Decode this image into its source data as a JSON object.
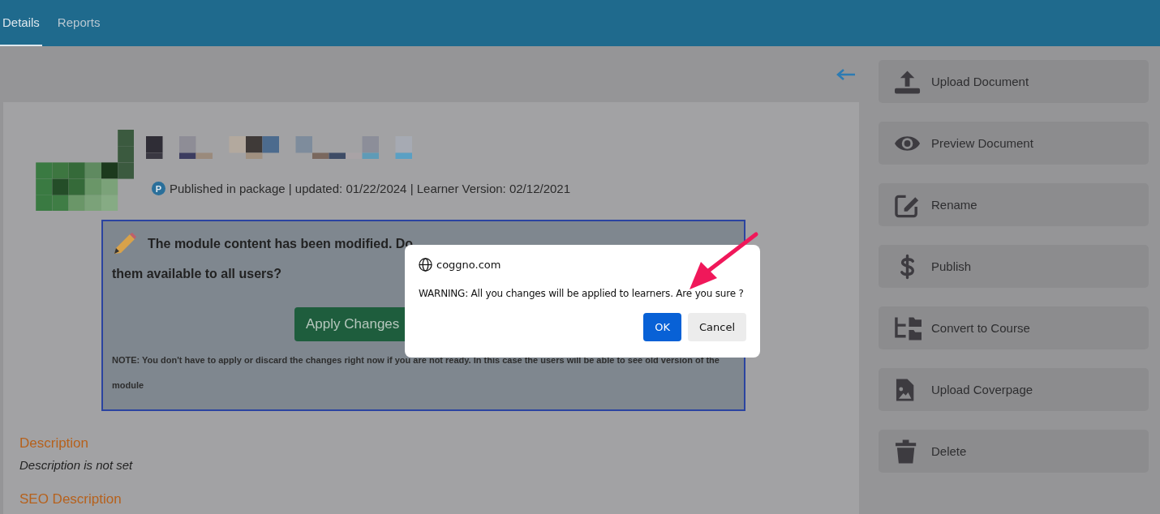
{
  "tabs": [
    {
      "label": "Details",
      "selected": true
    },
    {
      "label": "Reports",
      "selected": false
    }
  ],
  "module": {
    "status_badge": "P",
    "status": "Published in package | updated: 01/22/2024 | Learner Version: 02/12/2021",
    "notice": {
      "message_lines": [
        "The module content has been modified. Do",
        "them available to all users?"
      ],
      "apply_button": "Apply Changes",
      "note": "NOTE: You don't have to apply or discard the changes right now if you are not ready. In this case the users will be able to see old version of the module"
    }
  },
  "sections": [
    {
      "heading": "Description",
      "text": "Description is not set"
    },
    {
      "heading": "SEO Description"
    }
  ],
  "actions": [
    {
      "label": "Upload Document",
      "kind": "upload"
    },
    {
      "label": "Preview Document",
      "kind": "eye"
    },
    {
      "label": "Rename",
      "kind": "edit"
    },
    {
      "label": "Publish",
      "kind": "dollar"
    },
    {
      "label": "Convert to Course",
      "kind": "tree"
    },
    {
      "label": "Upload Coverpage",
      "kind": "image-file"
    },
    {
      "label": "Delete",
      "kind": "trash"
    }
  ],
  "dialog": {
    "origin": "coggno.com",
    "message": "WARNING: All you changes will be applied to learners. Are you sure ?",
    "buttons": [
      {
        "label": "OK",
        "kind": "primary"
      },
      {
        "label": "Cancel",
        "kind": "secondary"
      }
    ]
  }
}
